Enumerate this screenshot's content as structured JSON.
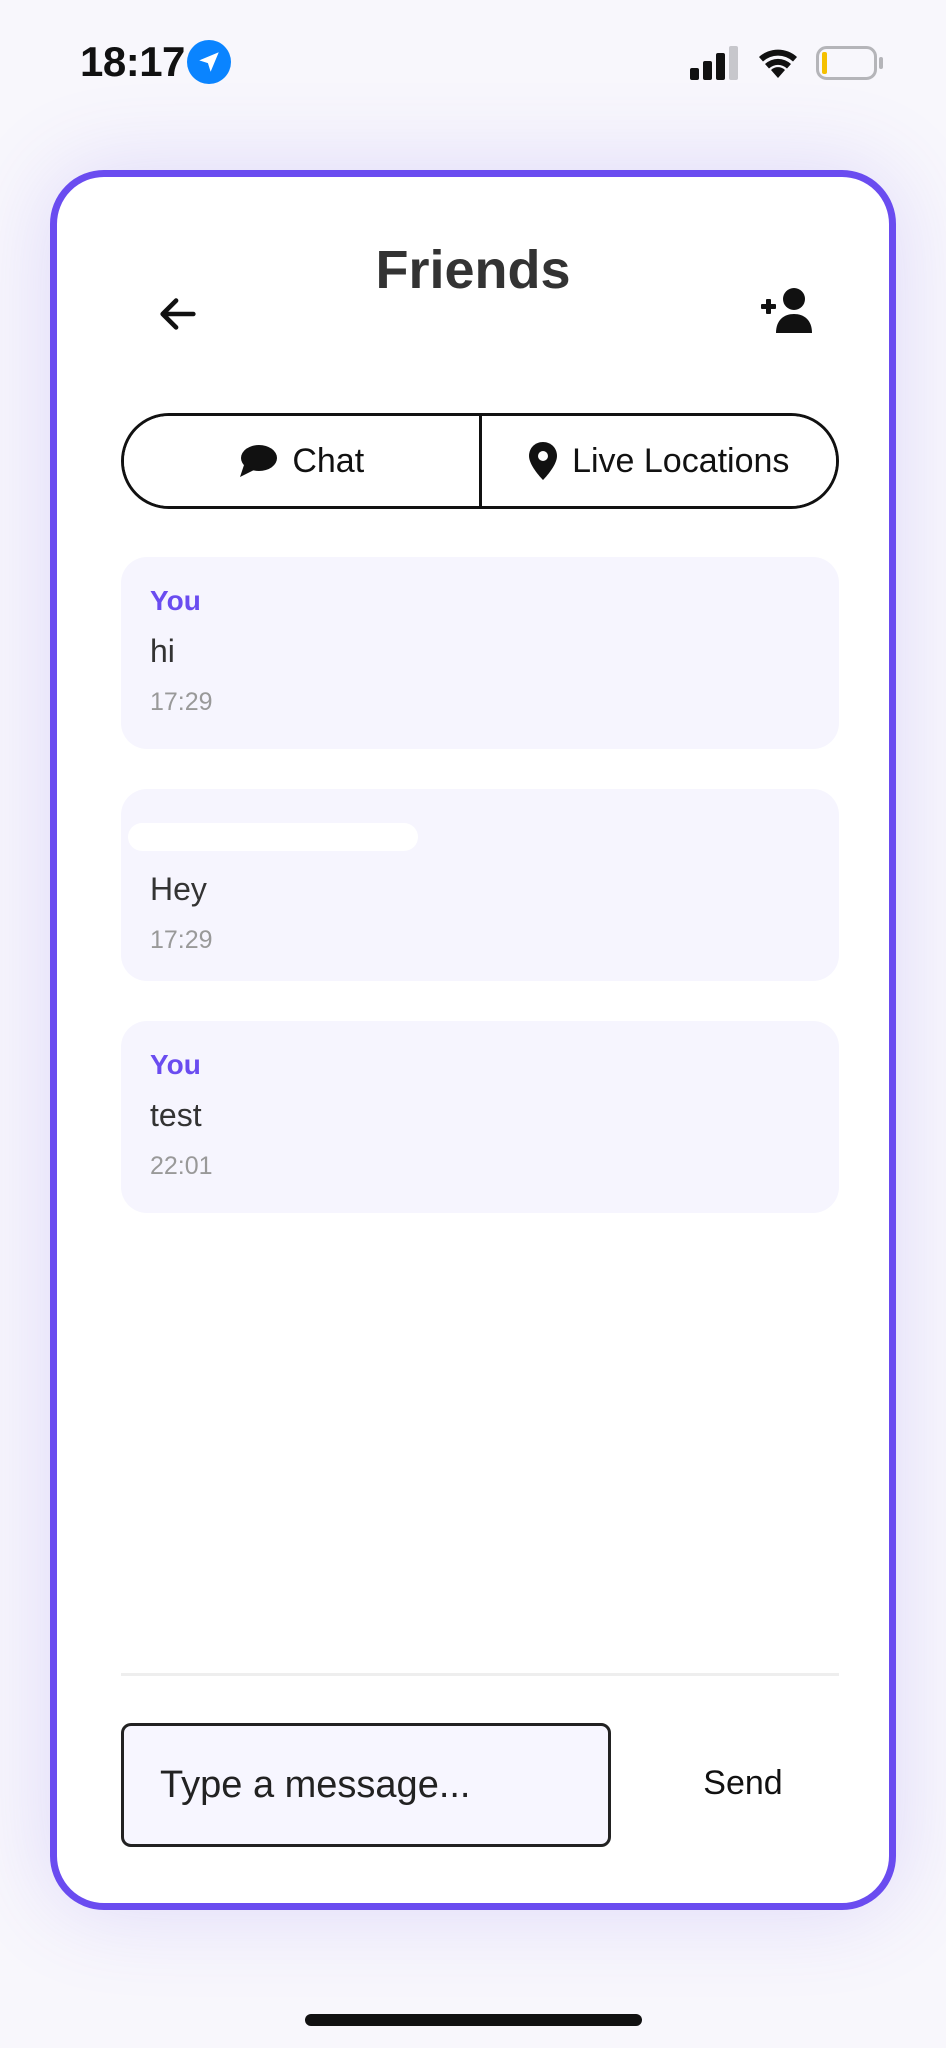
{
  "status_bar": {
    "time": "18:17",
    "icons": [
      "location-arrow-icon",
      "cellular-signal-icon",
      "wifi-icon",
      "battery-low-icon"
    ]
  },
  "header": {
    "title": "Friends",
    "back_icon": "arrow-left-icon",
    "add_icon": "user-plus-icon"
  },
  "tabs": [
    {
      "label": "Chat",
      "icon": "chat-bubble-icon"
    },
    {
      "label": "Live Locations",
      "icon": "map-pin-icon"
    }
  ],
  "messages": [
    {
      "sender": "You",
      "text": "hi",
      "time": "17:29"
    },
    {
      "sender": "",
      "text": "Hey",
      "time": "17:29"
    },
    {
      "sender": "You",
      "text": "test",
      "time": "22:01"
    }
  ],
  "composer": {
    "placeholder": "Type a message...",
    "send_label": "Send"
  },
  "colors": {
    "accent": "#6a4cf0",
    "bubble_bg": "#f6f5fe",
    "timestamp": "#999999"
  }
}
